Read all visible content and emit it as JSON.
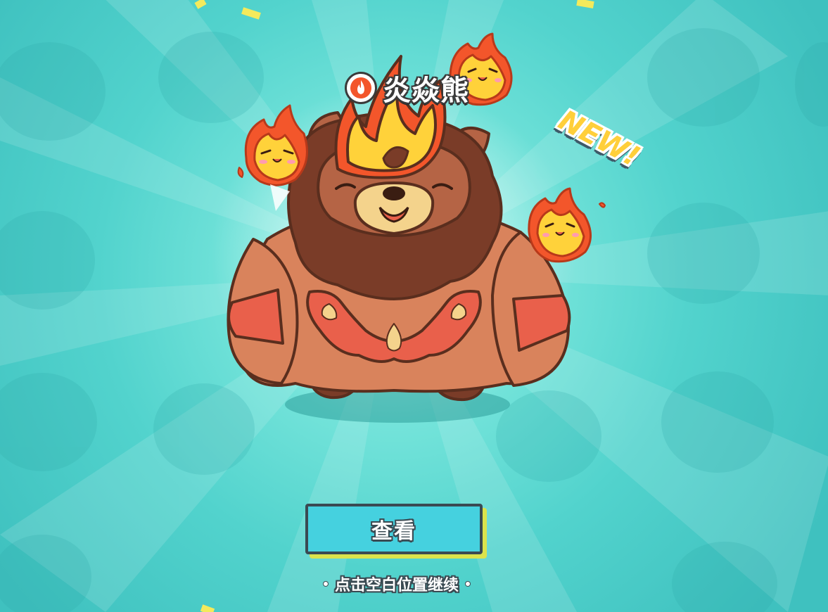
{
  "pet": {
    "name": "炎焱熊",
    "element_icon": "fire-icon",
    "new_label": "NEW!"
  },
  "actions": {
    "view_label": "查看",
    "continue_hint": "点击空白位置继续"
  },
  "colors": {
    "background": "#52d3cd",
    "button_fill": "#45d1df",
    "button_shadow": "#dbe34c",
    "new_badge": "#ffcf3a",
    "flame_outer": "#f3562b",
    "flame_inner": "#ffd23a",
    "bear_fur": "#d9835c",
    "bear_mane": "#7a3c28",
    "confetti": "#f4ea5b"
  }
}
